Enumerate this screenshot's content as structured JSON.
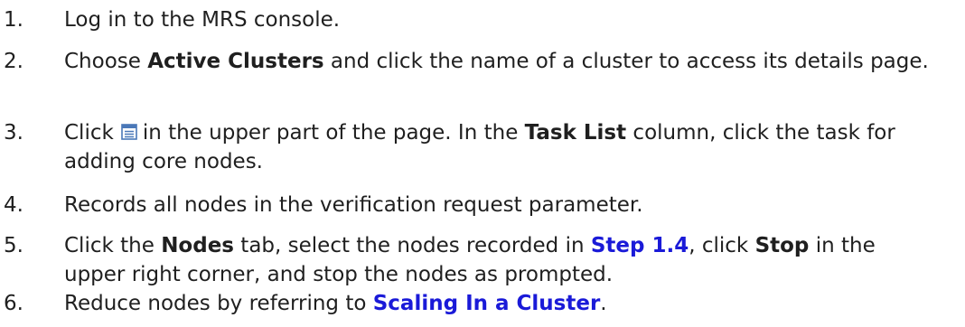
{
  "steps": [
    {
      "num": "1.",
      "a": "Log in to the MRS console."
    },
    {
      "num": "2.",
      "a": "Choose ",
      "b1": "Active Clusters",
      "c": " and click the name of a cluster to access its details page."
    },
    {
      "num": "3.",
      "a": "Click",
      "icon": "list-icon",
      "b": "in the upper part of the page. In the ",
      "b1": "Task List",
      "c": " column, click the task for adding core nodes."
    },
    {
      "num": "4.",
      "a": "Records all nodes in the verification request parameter."
    },
    {
      "num": "5.",
      "a": "Click the ",
      "b1": "Nodes",
      "c": " tab, select the nodes recorded in ",
      "link": "Step 1.4",
      "d": ", click ",
      "b2": "Stop",
      "e": " in the upper right corner, and stop the nodes as prompted."
    },
    {
      "num": "6.",
      "a": "Reduce nodes by referring to ",
      "link": "Scaling In a Cluster",
      "b": "."
    }
  ],
  "colors": {
    "text": "#1f1f1f",
    "link": "#1a1ad8",
    "icon": "#4a78b8"
  }
}
